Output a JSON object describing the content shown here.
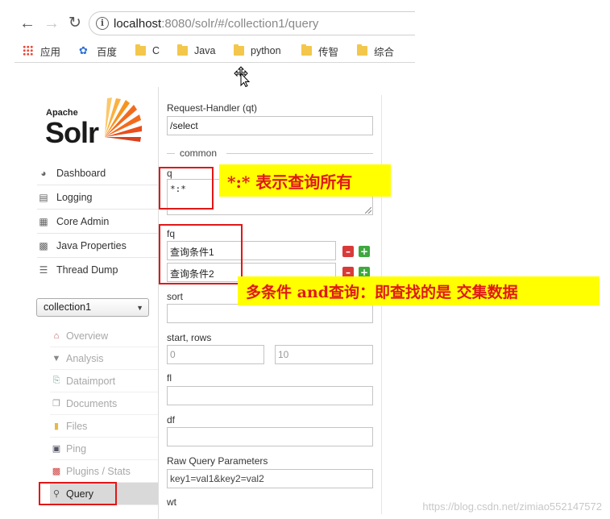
{
  "browser": {
    "url_host": "localhost",
    "url_rest": ":8080/solr/#/collection1/query",
    "bookmarks": [
      {
        "label": "应用",
        "icon": "apps-grid-icon"
      },
      {
        "label": "百度",
        "icon": "baidu-paw-icon"
      },
      {
        "label": "C",
        "icon": "folder-icon"
      },
      {
        "label": "Java",
        "icon": "folder-icon"
      },
      {
        "label": "python",
        "icon": "folder-icon"
      },
      {
        "label": "传智",
        "icon": "folder-icon"
      },
      {
        "label": "综合",
        "icon": "folder-icon"
      }
    ]
  },
  "logo": {
    "apache": "Apache",
    "solr": "Solr"
  },
  "main_nav": [
    {
      "label": "Dashboard",
      "icon": "dashboard-icon"
    },
    {
      "label": "Logging",
      "icon": "logging-icon"
    },
    {
      "label": "Core Admin",
      "icon": "core-admin-icon"
    },
    {
      "label": "Java Properties",
      "icon": "java-properties-icon"
    },
    {
      "label": "Thread Dump",
      "icon": "thread-dump-icon"
    }
  ],
  "core_selector": {
    "value": "collection1"
  },
  "core_nav": [
    {
      "label": "Overview",
      "icon": "home-icon"
    },
    {
      "label": "Analysis",
      "icon": "funnel-icon"
    },
    {
      "label": "Dataimport",
      "icon": "import-icon"
    },
    {
      "label": "Documents",
      "icon": "documents-icon"
    },
    {
      "label": "Files",
      "icon": "files-icon"
    },
    {
      "label": "Ping",
      "icon": "ping-icon"
    },
    {
      "label": "Plugins / Stats",
      "icon": "plugins-icon"
    },
    {
      "label": "Query",
      "icon": "magnifier-icon",
      "active": true
    }
  ],
  "form": {
    "request_handler_label": "Request-Handler (qt)",
    "request_handler_value": "/select",
    "common_legend": "common",
    "q_label": "q",
    "q_value": "*:*",
    "fq_label": "fq",
    "fq_values": [
      "查询条件1",
      "查询条件2"
    ],
    "sort_label": "sort",
    "start_rows_label": "start, rows",
    "start_value": "0",
    "rows_value": "10",
    "fl_label": "fl",
    "df_label": "df",
    "raw_label": "Raw Query Parameters",
    "raw_placeholder": "key1=val1&key2=val2",
    "wt_label": "wt"
  },
  "annotations": {
    "q_note": "*:*  表示查询所有",
    "fq_note": "多条件 and查询：即查找的是 交集数据",
    "color": "#e01818",
    "bg": "#ffff00"
  },
  "watermark": "https://blog.csdn.net/zimiao552147572"
}
